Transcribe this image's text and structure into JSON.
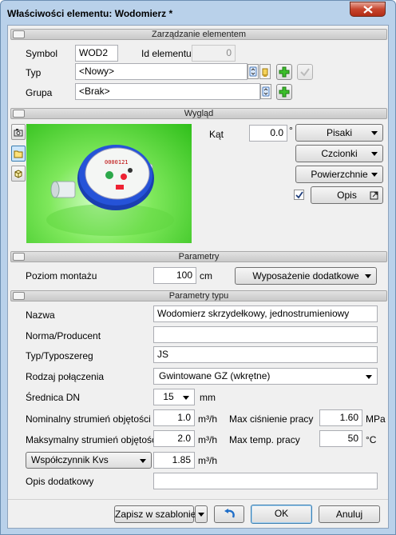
{
  "window": {
    "title": "Właściwości elementu: Wodomierz *"
  },
  "sections": {
    "management": "Zarządzanie elementem",
    "appearance": "Wygląd",
    "params": "Parametry",
    "type_params": "Parametry typu"
  },
  "management": {
    "symbol_label": "Symbol",
    "symbol_value": "WOD2",
    "id_label": "Id elementu",
    "id_value": "0",
    "type_label": "Typ",
    "type_value": "<Nowy>",
    "group_label": "Grupa",
    "group_value": "<Brak>"
  },
  "appearance": {
    "angle_label": "Kąt",
    "angle_value": "0.0",
    "angle_unit": "°",
    "pens_button": "Pisaki",
    "fonts_button": "Czcionki",
    "surfaces_button": "Powierzchnie",
    "desc_button": "Opis",
    "desc_checked": true,
    "meter_digits": "0000121"
  },
  "params": {
    "mount_level_label": "Poziom montażu",
    "mount_level_value": "100",
    "mount_level_unit": "cm",
    "extra_equipment_button": "Wyposażenie dodatkowe"
  },
  "type_params": {
    "name_label": "Nazwa",
    "name_value": "Wodomierz skrzydełkowy, jednostrumieniowy",
    "norm_label": "Norma/Producent",
    "norm_value": "",
    "series_label": "Typ/Typoszereg",
    "series_value": "JS",
    "connection_label": "Rodzaj połączenia",
    "connection_value": "Gwintowane GZ (wkrętne)",
    "dn_label": "Średnica DN",
    "dn_value": "15",
    "dn_unit": "mm",
    "nominal_flow_label": "Nominalny strumień objętości",
    "nominal_flow_value": "1.0",
    "nominal_flow_unit": "m³/h",
    "max_pressure_label": "Max ciśnienie pracy",
    "max_pressure_value": "1.60",
    "max_pressure_unit": "MPa",
    "max_flow_label": "Maksymalny strumień objętości",
    "max_flow_value": "2.0",
    "max_flow_unit": "m³/h",
    "max_temp_label": "Max temp. pracy",
    "max_temp_value": "50",
    "max_temp_unit": "°C",
    "kvs_select": "Współczynnik Kvs",
    "kvs_value": "1.85",
    "kvs_unit": "m³/h",
    "extra_desc_label": "Opis dodatkowy",
    "extra_desc_value": ""
  },
  "footer": {
    "save_template_button": "Zapisz w szablonie",
    "ok_button": "OK",
    "cancel_button": "Anuluj"
  }
}
